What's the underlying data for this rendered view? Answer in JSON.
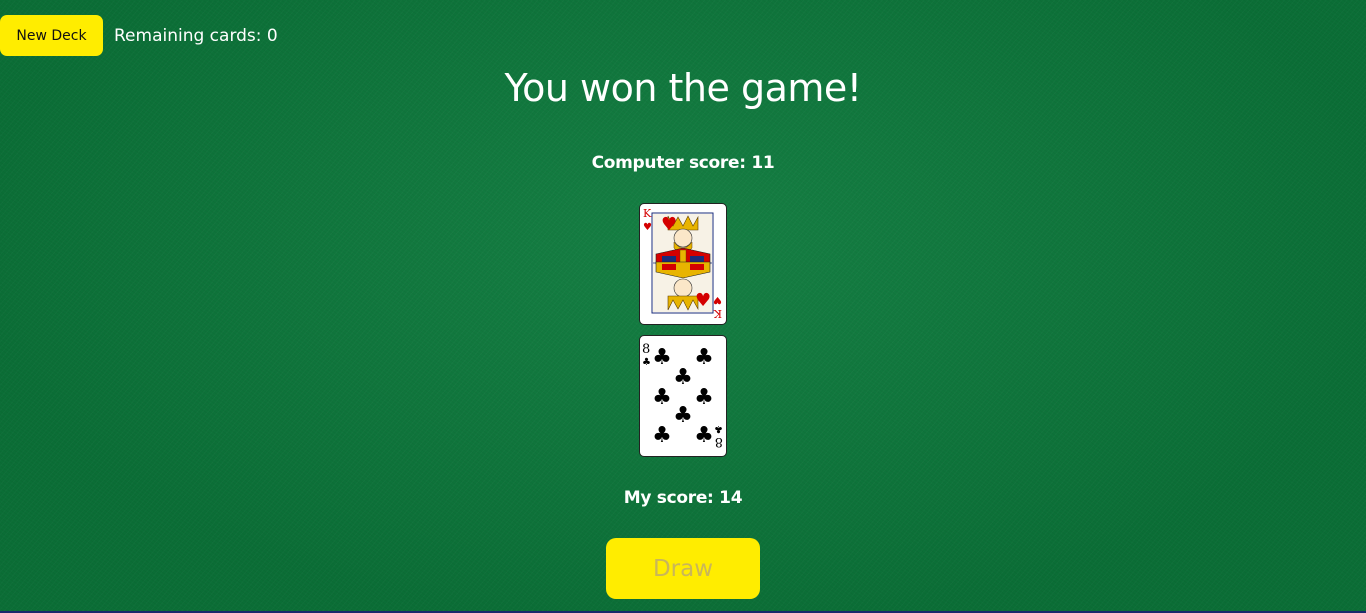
{
  "toolbar": {
    "new_deck_label": "New Deck",
    "remaining_label": "Remaining cards: 0"
  },
  "game": {
    "result_title": "You won the game!",
    "computer_score_label": "Computer score: 11",
    "my_score_label": "My score: 14",
    "draw_label": "Draw",
    "draw_disabled": true
  },
  "cards": {
    "computer_card": {
      "rank": "K",
      "suit": "hearts",
      "suit_symbol": "♥",
      "color": "#d40000"
    },
    "my_card": {
      "rank": "8",
      "suit": "clubs",
      "suit_symbol": "♣",
      "color": "#000000"
    }
  },
  "colors": {
    "felt": "#0c7a3c",
    "button_yellow": "#ffed00",
    "draw_text_disabled": "#c9b65a"
  }
}
